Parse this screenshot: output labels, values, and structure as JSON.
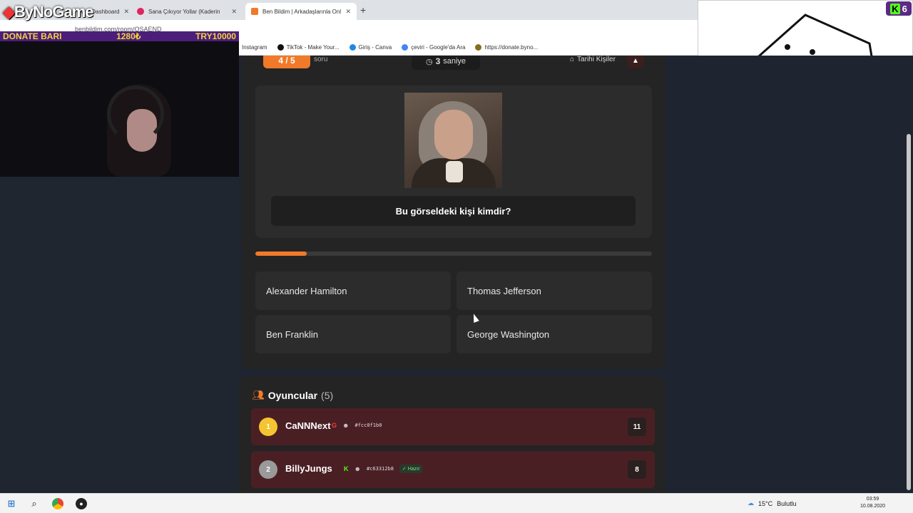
{
  "browser": {
    "tabs": [
      {
        "label": "Kick Dashboard"
      },
      {
        "label": "Sana Çıkıyor Yollar (Kaderin"
      },
      {
        "label": "Ben Bildim | Arkadaşlarınla Onl"
      }
    ],
    "url": "benbildim.com/room/OSAEND",
    "bookmarks": [
      "Instagram",
      "TikTok - Make Your...",
      "Giriş - Canva",
      "çeviri - Google'da Ara",
      "https://donate.byno..."
    ]
  },
  "overlay": {
    "logo": "ByNoGame",
    "donate_label": "DONATE BARI",
    "donate_current": "1280₺",
    "donate_goal": "TRY10000",
    "kick_badge": "6"
  },
  "quiz": {
    "progress_label": "4 / 5",
    "progress_sub": "soru",
    "timer_value": "3",
    "timer_unit": "saniye",
    "category": "Tarihi Kişiler",
    "question": "Bu görseldeki kişi kimdir?",
    "time_fraction": 0.13,
    "answers": [
      "Alexander Hamilton",
      "Thomas Jefferson",
      "Ben Franklin",
      "George Washington"
    ]
  },
  "players": {
    "title": "Oyuncular",
    "count": "(5)",
    "list": [
      {
        "rank": "1",
        "name": "CaNNNext",
        "hash": "#fcc0f1b0",
        "ready": "",
        "score": "11",
        "rank_color": "#f4c531"
      },
      {
        "rank": "2",
        "name": "BillyJungs",
        "hash": "#c63312b8",
        "ready": "Hazır",
        "score": "8",
        "rank_color": "#9a9a9a"
      }
    ]
  },
  "taskbar": {
    "weather": "15°C",
    "weather_desc": "Bulutlu",
    "time": "03:59",
    "date": "10.08.2020"
  },
  "colors": {
    "accent": "#f07a2a",
    "player_row": "#4a1f24",
    "panel": "#242424"
  }
}
